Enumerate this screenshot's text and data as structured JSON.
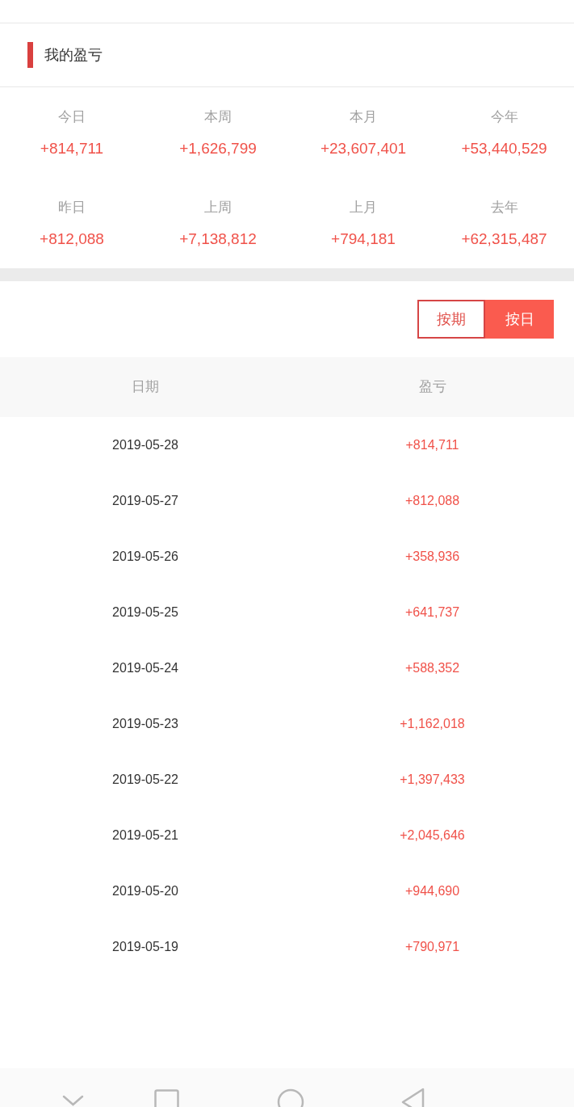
{
  "section": {
    "title": "我的盈亏"
  },
  "summary": [
    {
      "label": "今日",
      "value": "+814,711"
    },
    {
      "label": "本周",
      "value": "+1,626,799"
    },
    {
      "label": "本月",
      "value": "+23,607,401"
    },
    {
      "label": "今年",
      "value": "+53,440,529"
    },
    {
      "label": "昨日",
      "value": "+812,088"
    },
    {
      "label": "上周",
      "value": "+7,138,812"
    },
    {
      "label": "上月",
      "value": "+794,181"
    },
    {
      "label": "去年",
      "value": "+62,315,487"
    }
  ],
  "view_toggle": [
    {
      "label": "按期",
      "selected": false
    },
    {
      "label": "按日",
      "selected": true
    }
  ],
  "table": {
    "columns": [
      "日期",
      "盈亏"
    ],
    "rows": [
      {
        "date": "2019-05-28",
        "profit": "+814,711"
      },
      {
        "date": "2019-05-27",
        "profit": "+812,088"
      },
      {
        "date": "2019-05-26",
        "profit": "+358,936"
      },
      {
        "date": "2019-05-25",
        "profit": "+641,737"
      },
      {
        "date": "2019-05-24",
        "profit": "+588,352"
      },
      {
        "date": "2019-05-23",
        "profit": "+1,162,018"
      },
      {
        "date": "2019-05-22",
        "profit": "+1,397,433"
      },
      {
        "date": "2019-05-21",
        "profit": "+2,045,646"
      },
      {
        "date": "2019-05-20",
        "profit": "+944,690"
      },
      {
        "date": "2019-05-19",
        "profit": "+790,971"
      }
    ]
  }
}
